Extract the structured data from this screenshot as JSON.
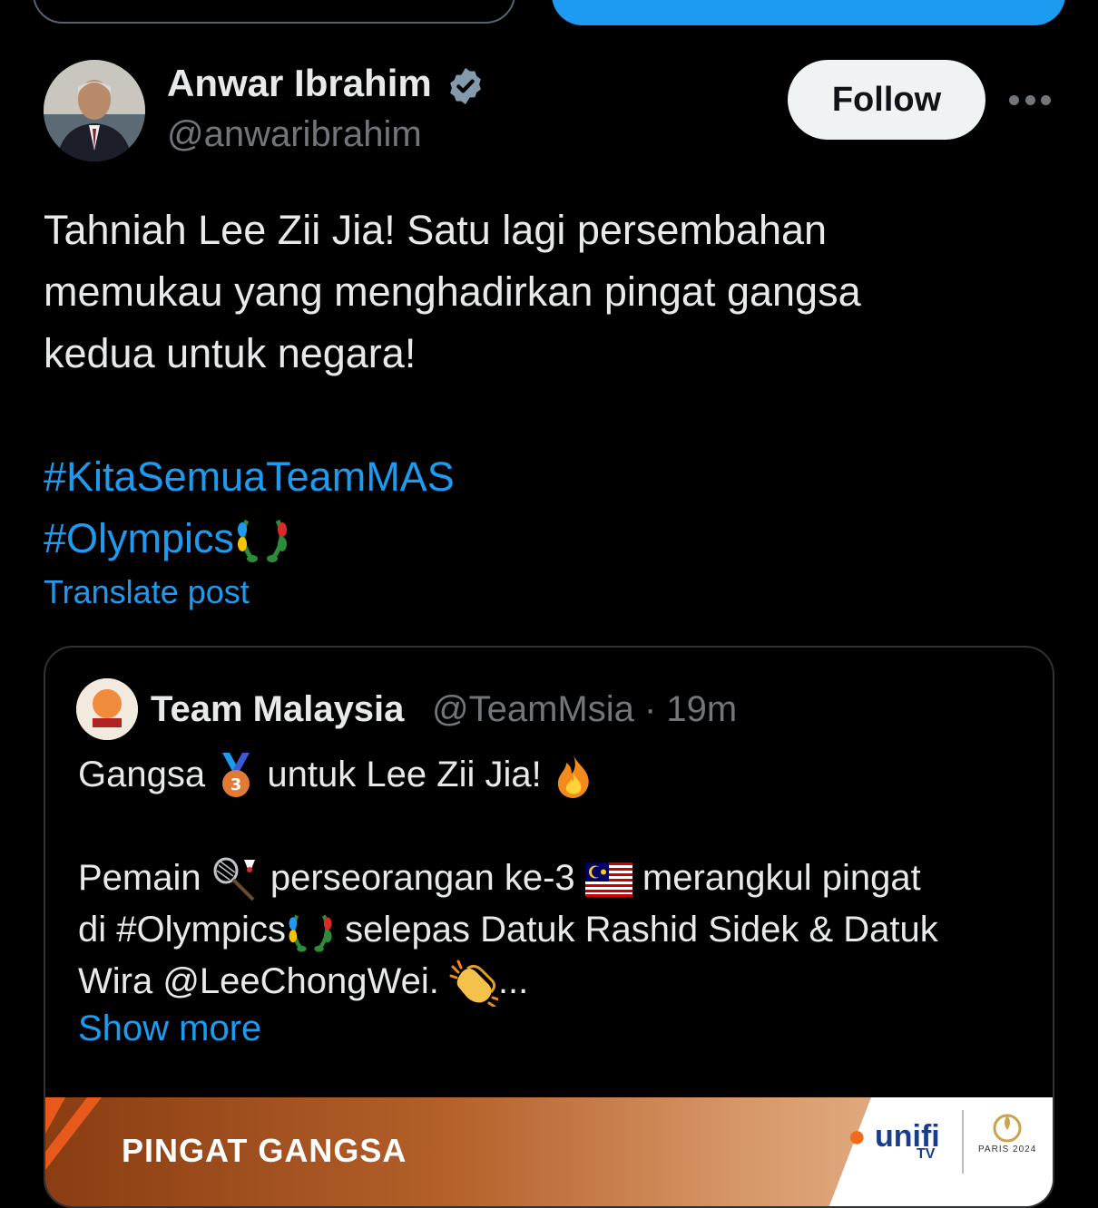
{
  "top_buttons": {
    "outline_label": "",
    "primary_label": ""
  },
  "author": {
    "display_name": "Anwar Ibrahim",
    "handle": "@anwaribrahim",
    "verified": true
  },
  "actions": {
    "follow_label": "Follow",
    "more_icon": "more-icon"
  },
  "post": {
    "lines": [
      "Tahniah Lee Zii Jia! Satu lagi persembahan",
      "memukau yang menghadirkan pingat gangsa",
      "kedua untuk negara!"
    ],
    "hashtags": [
      "#KitaSemuaTeamMAS",
      "#Olympics"
    ],
    "translate_label": "Translate post"
  },
  "quote": {
    "name": "Team Malaysia",
    "handle_time": "@TeamMsia · 19m",
    "line1_a": "Gangsa",
    "line1_b": "untuk Lee Zii Jia!",
    "line2_a": "Pemain",
    "line2_b": "perseorangan ke-3",
    "line2_c": "merangkul pingat",
    "line3_a": "di #Olympics",
    "line3_b": "selepas Datuk Rashid Sidek & Datuk",
    "line4_a": "Wira @LeeChongWei.",
    "line4_b": "...",
    "show_more": "Show more"
  },
  "banner": {
    "title": "PINGAT GANGSA",
    "sponsor": "unifi",
    "sponsor_sub": "TV",
    "event": "PARIS 2024"
  },
  "colors": {
    "accent": "#1d9bf0",
    "text": "#e7e9ea",
    "muted": "#71767b",
    "border": "#2f3336"
  }
}
